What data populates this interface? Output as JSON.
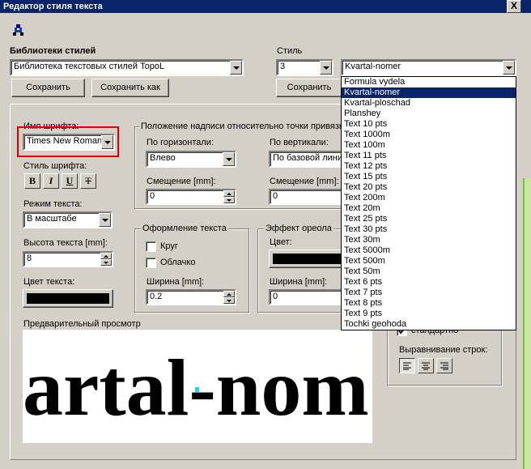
{
  "window": {
    "title": "Редактор стиля текста",
    "close_glyph": "X"
  },
  "libraries": {
    "label": "Библиотеки стилей",
    "selected": "Библиотека текстовых стилей TopoL",
    "save": "Сохранить",
    "save_as": "Сохранить как"
  },
  "style": {
    "label": "Стиль",
    "number": "3",
    "name": "Kvartal-nomer",
    "save": "Сохранить",
    "options": [
      "Formula vydela",
      "Kvartal-nomer",
      "Kvartal-ploschad",
      "Planshey",
      "Text 10 pts",
      "Text 1000m",
      "Text 100m",
      "Text 11 pts",
      "Text 12 pts",
      "Text 15 pts",
      "Text 20 pts",
      "Text 200m",
      "Text 20m",
      "Text 25 pts",
      "Text 30 pts",
      "Text 30m",
      "Text 5000m",
      "Text 500m",
      "Text 50m",
      "Text 6 pts",
      "Text 7 pts",
      "Text 8 pts",
      "Text 9 pts",
      "Tochki geohoda"
    ],
    "selected_index": 1
  },
  "font": {
    "name_label": "Имя шрифта:",
    "name_value": "Times New Roman",
    "style_label": "Стиль шрифта:",
    "bold": "B",
    "italic": "I",
    "underline": "U",
    "strike": "T",
    "mode_label": "Режим текста:",
    "mode_value": "В масштабе",
    "height_label": "Высота текста [mm]:",
    "height_value": "8",
    "color_label": "Цвет текста:",
    "color": "#000000"
  },
  "position": {
    "title": "Положение надписи относительно точки привязки",
    "horizontal_label": "По горизонтали:",
    "horizontal_value": "Влево",
    "vertical_label": "По вертикали:",
    "vertical_value": "По базовой линии",
    "h_offset_label": "Смещение [mm]:",
    "h_offset_value": "0",
    "v_offset_label": "Смещение [mm]:",
    "v_offset_value": "0"
  },
  "decoration": {
    "title": "Оформление текста",
    "circle": "Круг",
    "cloud": "Облачко",
    "width_label": "Ширина [mm]:",
    "width_value": "0.2"
  },
  "halo": {
    "title": "Эффект ореола",
    "color_label": "Цвет:",
    "width_label": "Ширина [mm]:",
    "width_value": "0"
  },
  "alignment": {
    "standard_label": "стандартно",
    "lines_label": "Выравнивание строк:"
  },
  "preview": {
    "label": "Предварительный просмотр",
    "text": "artal-nom",
    "anchor_color": "#00e5ff"
  }
}
